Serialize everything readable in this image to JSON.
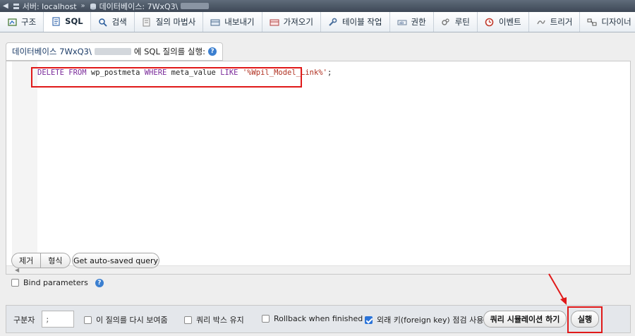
{
  "breadcrumb": {
    "server_label": "서버: localhost",
    "separator": "»",
    "database_label": "데이터베이스: 7WxQ3\\"
  },
  "tabs": [
    {
      "label": "구조",
      "icon": "structure-icon",
      "active": false
    },
    {
      "label": "SQL",
      "icon": "sql-icon",
      "active": true
    },
    {
      "label": "검색",
      "icon": "search-icon",
      "active": false
    },
    {
      "label": "질의 마법사",
      "icon": "query-icon",
      "active": false
    },
    {
      "label": "내보내기",
      "icon": "export-icon",
      "active": false
    },
    {
      "label": "가져오기",
      "icon": "import-icon",
      "active": false
    },
    {
      "label": "테이블 작업",
      "icon": "wrench-icon",
      "active": false
    },
    {
      "label": "권한",
      "icon": "privileges-icon",
      "active": false
    },
    {
      "label": "루틴",
      "icon": "routines-icon",
      "active": false
    },
    {
      "label": "이벤트",
      "icon": "events-icon",
      "active": false
    },
    {
      "label": "트리거",
      "icon": "triggers-icon",
      "active": false
    },
    {
      "label": "디자이너",
      "icon": "designer-icon",
      "active": false
    }
  ],
  "heading": {
    "prefix": "데이터베이스 7WxQ3\\",
    "suffix": "에 SQL 질의를 실행:"
  },
  "sql": {
    "kw1": "DELETE FROM",
    "table": " wp_postmeta ",
    "kw2": "WHERE",
    "field": " meta_value ",
    "kw3": "LIKE",
    "space": " ",
    "value": "'%Wpil_Model_Link%'",
    "end": ";"
  },
  "buttons": {
    "clear": "제거",
    "format": "형식",
    "autosaved": "Get auto-saved query",
    "simulate": "쿼리 시뮬레이션 하기",
    "go": "실행"
  },
  "bind_parameters": "Bind parameters",
  "bottom": {
    "delimiter_label": "구분자",
    "delimiter_value": ";",
    "show_again": "이 질의를 다시 보여줌",
    "retain_box": "쿼리 박스 유지",
    "rollback": "Rollback when finished",
    "fk_checks": "외래 키(foreign key) 점검 사용"
  },
  "colors": {
    "highlight": "#e01919",
    "keyword": "#7a2a9a",
    "string": "#b03020"
  }
}
